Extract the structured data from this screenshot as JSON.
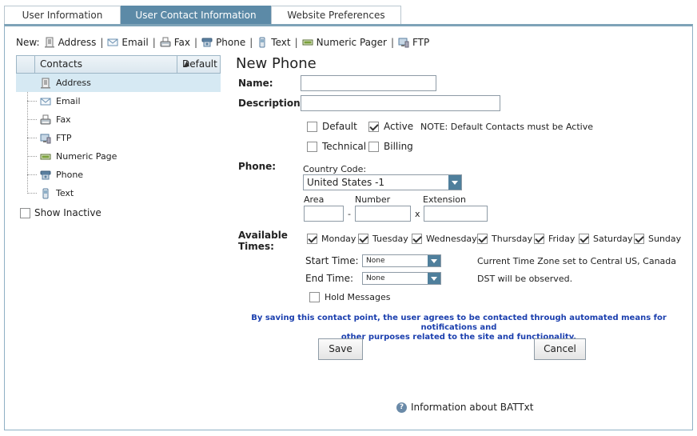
{
  "tabs": [
    {
      "label": "User Information"
    },
    {
      "label": "User Contact Information",
      "active": true
    },
    {
      "label": "Website Preferences"
    }
  ],
  "newbar": {
    "prefix": "New:",
    "items": [
      {
        "label": "Address",
        "icon": "address-icon"
      },
      {
        "label": "Email",
        "icon": "email-icon"
      },
      {
        "label": "Fax",
        "icon": "fax-icon"
      },
      {
        "label": "Phone",
        "icon": "phone-icon"
      },
      {
        "label": "Text",
        "icon": "text-icon"
      },
      {
        "label": "Numeric Pager",
        "icon": "pager-icon"
      },
      {
        "label": "FTP",
        "icon": "ftp-icon"
      }
    ]
  },
  "tree": {
    "col_contacts": "Contacts",
    "col_default": "Default",
    "items": [
      {
        "label": "Address",
        "icon": "address-icon"
      },
      {
        "label": "Email",
        "icon": "email-icon"
      },
      {
        "label": "Fax",
        "icon": "fax-icon"
      },
      {
        "label": "FTP",
        "icon": "ftp-icon"
      },
      {
        "label": "Numeric Page",
        "icon": "pager-icon"
      },
      {
        "label": "Phone",
        "icon": "phone-icon"
      },
      {
        "label": "Text",
        "icon": "text-icon"
      }
    ],
    "show_inactive": "Show Inactive"
  },
  "form": {
    "title": "New Phone",
    "name_label": "Name:",
    "name_value": "",
    "description_label": "Description:",
    "description_value": "",
    "options": {
      "default": {
        "label": "Default",
        "checked": false
      },
      "active": {
        "label": "Active",
        "checked": true
      },
      "technical": {
        "label": "Technical",
        "checked": false
      },
      "billing": {
        "label": "Billing",
        "checked": false
      }
    },
    "active_note": "NOTE: Default Contacts must be Active",
    "phone_label": "Phone:",
    "country_code_label": "Country Code:",
    "country_value": "United States -1",
    "area_label": "Area",
    "number_label": "Number",
    "extension_label": "Extension",
    "dash": "-",
    "x": "x",
    "available_label_1": "Available",
    "available_label_2": "Times:",
    "days": [
      {
        "label": "Monday",
        "checked": true
      },
      {
        "label": "Tuesday",
        "checked": true
      },
      {
        "label": "Wednesday",
        "checked": true
      },
      {
        "label": "Thursday",
        "checked": true
      },
      {
        "label": "Friday",
        "checked": true
      },
      {
        "label": "Saturday",
        "checked": true
      },
      {
        "label": "Sunday",
        "checked": true
      }
    ],
    "start_time_label": "Start Time:",
    "start_time_value": "None",
    "end_time_label": "End Time:",
    "end_time_value": "None",
    "timezone_note": "Current Time Zone set to Central US, Canada",
    "dst_note": "DST will be observed.",
    "hold_messages": {
      "label": "Hold Messages",
      "checked": false
    },
    "disclaimer_1": "By saving this contact point, the user agrees to be contacted through automated means for notifications and",
    "disclaimer_2": "other purposes related to the site and functionality.",
    "save_label": "Save",
    "cancel_label": "Cancel"
  },
  "info": {
    "label": "Information about BATTxt",
    "icon": "info-icon"
  },
  "colors": {
    "tab_active": "#5c8aa7",
    "disclaimer": "#1b3fae",
    "selected_row": "#d6e9f3",
    "dropdown": "#4f7f9c"
  }
}
